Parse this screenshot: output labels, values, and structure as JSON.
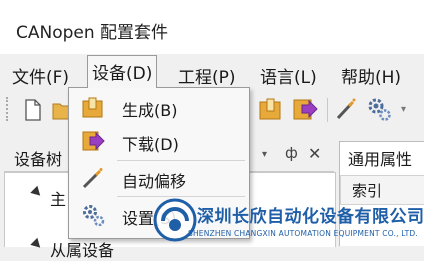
{
  "window": {
    "title": "CANopen 配置套件"
  },
  "menubar": {
    "items": [
      {
        "label": "文件(F)"
      },
      {
        "label": "设备(D)"
      },
      {
        "label": "工程(P)"
      },
      {
        "label": "语言(L)"
      },
      {
        "label": "帮助(H)"
      }
    ]
  },
  "dropdown": {
    "items": [
      {
        "label": "生成(B)",
        "icon": "build-icon"
      },
      {
        "label": "下载(D)",
        "icon": "download-icon"
      },
      {
        "label": "自动偏移",
        "icon": "magic-wand-icon"
      },
      {
        "label": "设置(S)",
        "icon": "gear-icon"
      }
    ]
  },
  "tree_panel": {
    "title": "设备树",
    "pin": "ф",
    "close": "✕",
    "nodes": [
      {
        "label": "主"
      },
      {
        "label": "从属设备"
      }
    ]
  },
  "props_panel": {
    "title": "通用属性",
    "column": "索引"
  },
  "watermark": {
    "company_cn": "深圳长欣自动化设备有限公司",
    "company_en": "SHENZHEN CHANGXIN AUTOMATION EQUIPMENT CO., LTD."
  },
  "colors": {
    "accent": "#1f5fa8",
    "icon_gold": "#e3a22a",
    "icon_purple": "#8b3fb3"
  }
}
